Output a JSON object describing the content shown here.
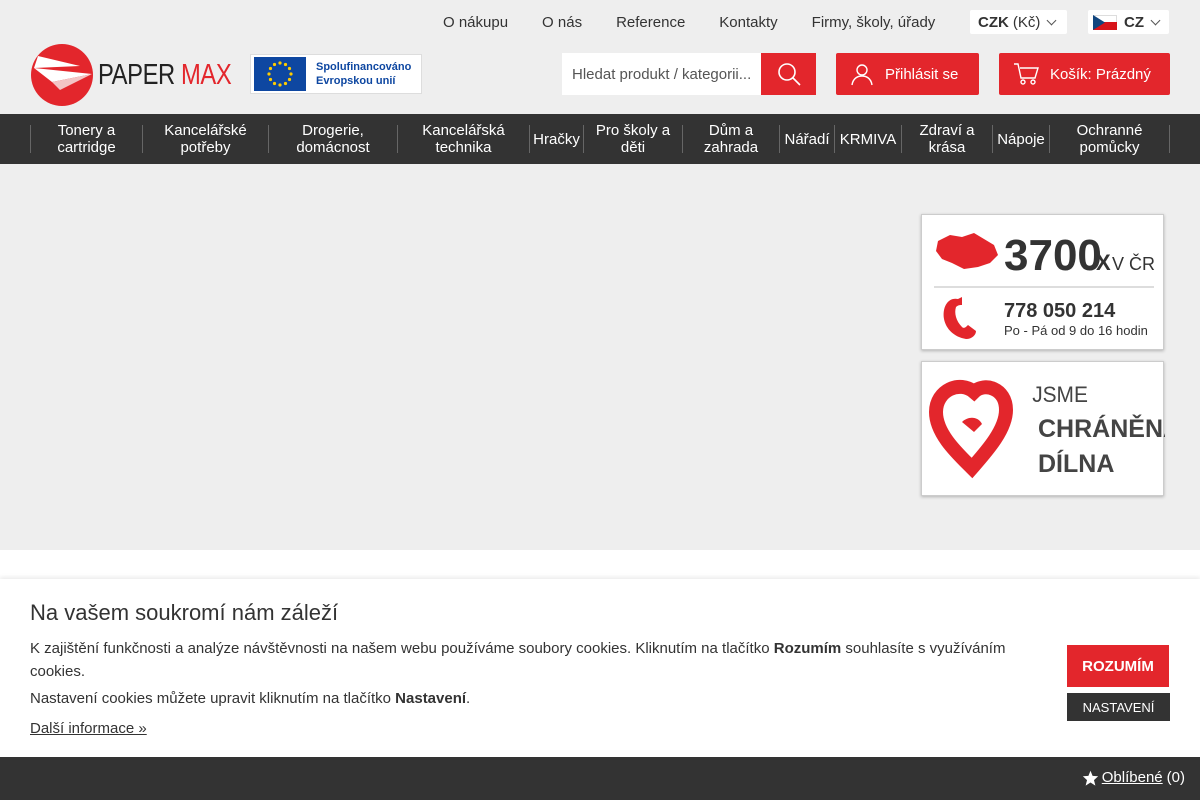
{
  "topnav": [
    {
      "label": "O nákupu"
    },
    {
      "label": "O nás"
    },
    {
      "label": "Reference"
    },
    {
      "label": "Kontakty"
    },
    {
      "label": "Firmy, školy, úřady"
    }
  ],
  "currency": {
    "code": "CZK",
    "symbol": "(Kč)"
  },
  "language": {
    "code": "CZ"
  },
  "logo": {
    "text_paper": "PAPER",
    "text_max": "MAX"
  },
  "eu_badge": {
    "line1": "Spolufinancováno",
    "line2": "Evropskou unií"
  },
  "search": {
    "placeholder": "Hledat produkt / kategorii..."
  },
  "login": {
    "label": "Přihlásit se"
  },
  "cart": {
    "label": "Košík: Prázdný"
  },
  "categories": [
    {
      "line1": "Tonery a",
      "line2": "cartridge"
    },
    {
      "line1": "Kancelářské",
      "line2": "potřeby"
    },
    {
      "line1": "Drogerie,",
      "line2": "domácnost"
    },
    {
      "line1": "Kancelářská",
      "line2": "technika"
    },
    {
      "line1": "Hračky",
      "line2": ""
    },
    {
      "line1": "Pro školy a",
      "line2": "děti"
    },
    {
      "line1": "Dům a",
      "line2": "zahrada"
    },
    {
      "line1": "Nářadí",
      "line2": ""
    },
    {
      "line1": "KRMIVA",
      "line2": ""
    },
    {
      "line1": "Zdraví a",
      "line2": "krása"
    },
    {
      "line1": "Nápoje",
      "line2": ""
    },
    {
      "line1": "Ochranné",
      "line2": "pomůcky"
    }
  ],
  "banner_count": {
    "big": "3700",
    "x": "X",
    "suffix": "V ČR",
    "phone": "778 050 214",
    "hours": "Po - Pá od 9 do 16 hodin"
  },
  "banner_heart": {
    "line1": "JSME",
    "line2": "CHRÁNĚNÁ",
    "line3": "DÍLNA"
  },
  "cookie": {
    "title": "Na vašem soukromí nám záleží",
    "text1_a": "K zajištění funkčnosti a analýze návštěvnosti na našem webu používáme soubory cookies. Kliknutím na tlačítko ",
    "text1_b": "Rozumím",
    "text1_c": " souhlasíte s využíváním cookies.",
    "text2_a": "Nastavení cookies můžete upravit kliknutím na tlačítko ",
    "text2_b": "Nastavení",
    "text2_c": ".",
    "more": "Další informace »",
    "accept": "ROZUMÍM",
    "settings": "NASTAVENÍ"
  },
  "favorites": {
    "label": "Oblíbené",
    "count": "(0)"
  },
  "colors": {
    "brand_red": "#e3262c",
    "dark": "#333333",
    "eu_blue": "#0e47a1"
  }
}
